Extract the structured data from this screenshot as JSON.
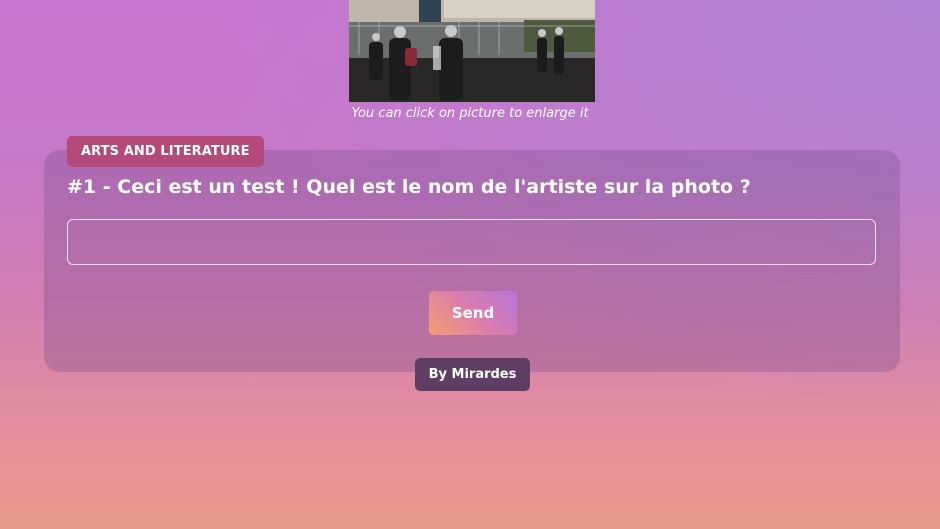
{
  "photo": {
    "hint": "You can click on picture to enlarge it"
  },
  "quiz": {
    "category": "ARTS AND LITERATURE",
    "question": "#1 - Ceci est un test ! Quel est le nom de l'artiste sur la photo ?",
    "answer_value": "",
    "send_label": "Send"
  },
  "footer": {
    "byline": "By Mirardes"
  },
  "colors": {
    "category_bg": "#b34a7a",
    "byline_bg": "#5e3f63",
    "send_gradient": [
      "#f2a06e",
      "#d97ab2",
      "#b477d7"
    ]
  }
}
